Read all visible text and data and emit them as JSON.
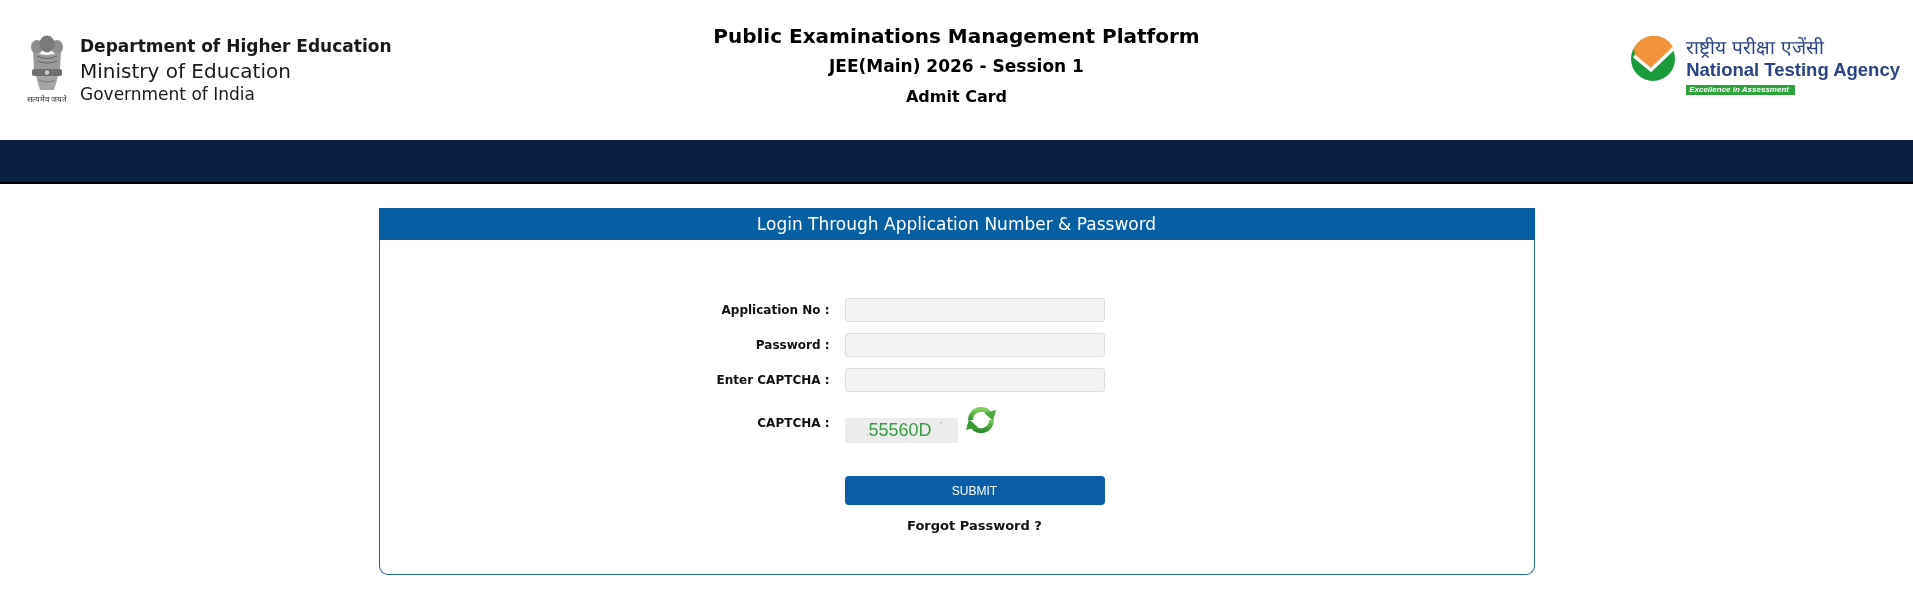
{
  "header": {
    "department": {
      "emblem_motto": "सत्यमेव जयते",
      "title": "Department of Higher Education",
      "ministry": "Ministry of Education",
      "government": "Government of India"
    },
    "platform": {
      "title": "Public Examinations Management Platform",
      "exam": "JEE(Main) 2026 - Session 1",
      "page": "Admit Card"
    },
    "agency": {
      "hindi_name": "राष्ट्रीय परीक्षा एजेंसी",
      "name": "National Testing Agency",
      "tagline": "Excellence in Assessment"
    }
  },
  "login_panel": {
    "title": "Login Through Application Number & Password",
    "fields": [
      {
        "label": "Application No :"
      },
      {
        "label": "Password :"
      },
      {
        "label": "Enter CAPTCHA :"
      }
    ],
    "captcha": {
      "label": "CAPTCHA :",
      "code": "55560D"
    },
    "submit": "SUBMIT",
    "forgot_link": "Forgot Password ?"
  }
}
